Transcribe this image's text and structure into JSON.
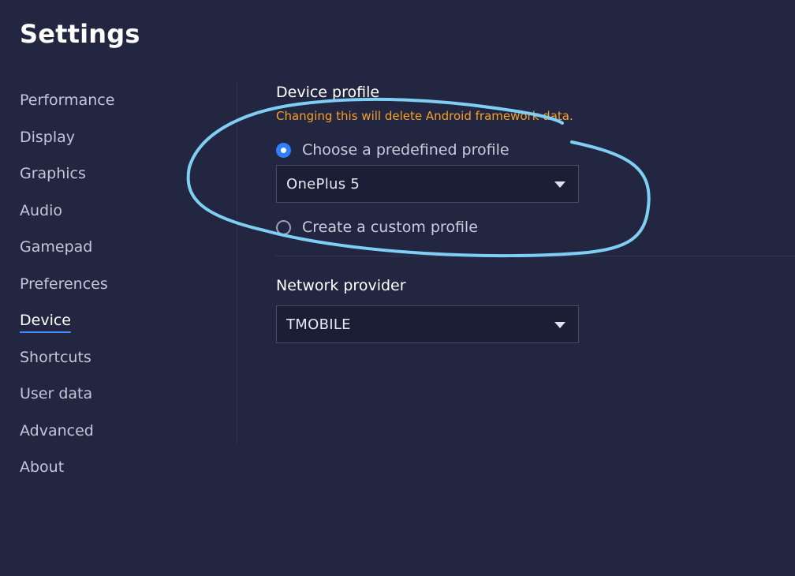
{
  "page": {
    "title": "Settings"
  },
  "sidebar": {
    "items": [
      {
        "label": "Performance"
      },
      {
        "label": "Display"
      },
      {
        "label": "Graphics"
      },
      {
        "label": "Audio"
      },
      {
        "label": "Gamepad"
      },
      {
        "label": "Preferences"
      },
      {
        "label": "Device",
        "active": true
      },
      {
        "label": "Shortcuts"
      },
      {
        "label": "User data"
      },
      {
        "label": "Advanced"
      },
      {
        "label": "About"
      }
    ]
  },
  "device_profile": {
    "title": "Device profile",
    "warning": "Changing this will delete Android framework data.",
    "option_predefined": "Choose a predefined profile",
    "option_predefined_selected": true,
    "profile_value": "OnePlus 5",
    "option_custom": "Create a custom profile",
    "option_custom_selected": false
  },
  "network": {
    "title": "Network provider",
    "value": "TMOBILE"
  },
  "colors": {
    "background": "#222640",
    "accent": "#2f80ff",
    "warning": "#f5a12a",
    "annotation": "#7fcff5"
  },
  "icons": {
    "dropdown": "caret-down-icon",
    "radio_on": "radio-checked-icon",
    "radio_off": "radio-unchecked-icon"
  }
}
